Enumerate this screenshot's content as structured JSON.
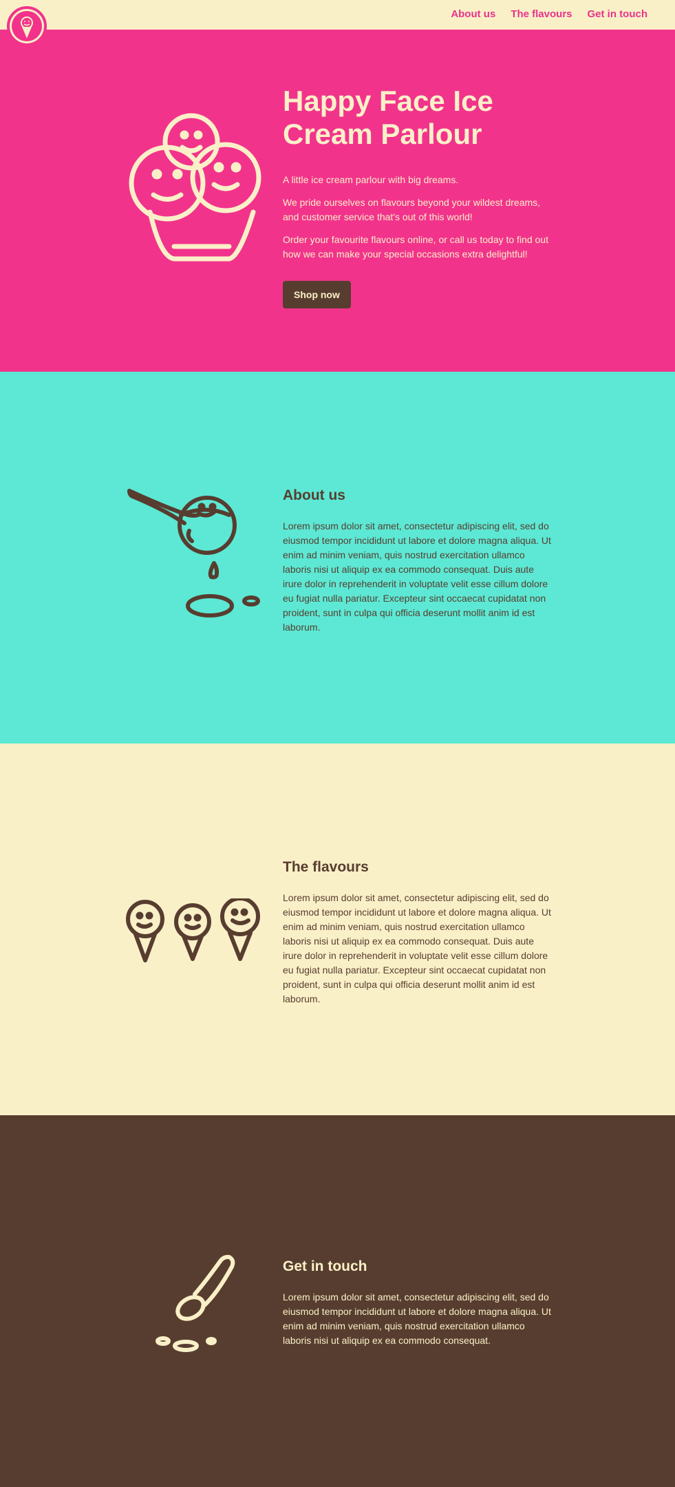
{
  "nav": {
    "items": [
      "About us",
      "The flavours",
      "Get in touch"
    ]
  },
  "hero": {
    "title": "Happy Face Ice Cream Parlour",
    "p1": "A little ice cream parlour with big dreams.",
    "p2": "We pride ourselves on flavours beyond your wildest dreams, and customer service that's out of this world!",
    "p3": "Order your favourite flavours online, or call us today to find out how we can make your special occasions extra delightful!",
    "button": "Shop now"
  },
  "about": {
    "heading": "About us",
    "text": "Lorem ipsum dolor sit amet, consectetur adipiscing elit, sed do eiusmod tempor incididunt ut labore et dolore magna aliqua. Ut enim ad minim veniam, quis nostrud exercitation ullamco laboris nisi ut aliquip ex ea commodo consequat. Duis aute irure dolor in reprehenderit in voluptate velit esse cillum dolore eu fugiat nulla pariatur. Excepteur sint occaecat cupidatat non proident, sunt in culpa qui officia deserunt mollit anim id est laborum."
  },
  "flavours": {
    "heading": "The flavours",
    "text": "Lorem ipsum dolor sit amet, consectetur adipiscing elit, sed do eiusmod tempor incididunt ut labore et dolore magna aliqua. Ut enim ad minim veniam, quis nostrud exercitation ullamco laboris nisi ut aliquip ex ea commodo consequat. Duis aute irure dolor in reprehenderit in voluptate velit esse cillum dolore eu fugiat nulla pariatur. Excepteur sint occaecat cupidatat non proident, sunt in culpa qui officia deserunt mollit anim id est laborum."
  },
  "contact": {
    "heading": "Get in touch",
    "text": "Lorem ipsum dolor sit amet, consectetur adipiscing elit, sed do eiusmod tempor incididunt ut labore et dolore magna aliqua. Ut enim ad minim veniam, quis nostrud exercitation ullamco laboris nisi ut aliquip ex ea commodo consequat."
  },
  "colors": {
    "pink": "#f2338c",
    "cream": "#faf0c8",
    "teal": "#5ce8d4",
    "brown": "#573d2f"
  },
  "icons": {
    "logo": "ice-cream-cone-face-icon",
    "hero": "three-scoop-ice-cream-icon",
    "about": "scoop-pouring-icon",
    "flavours": "three-cones-icon",
    "contact": "spoon-icon"
  }
}
